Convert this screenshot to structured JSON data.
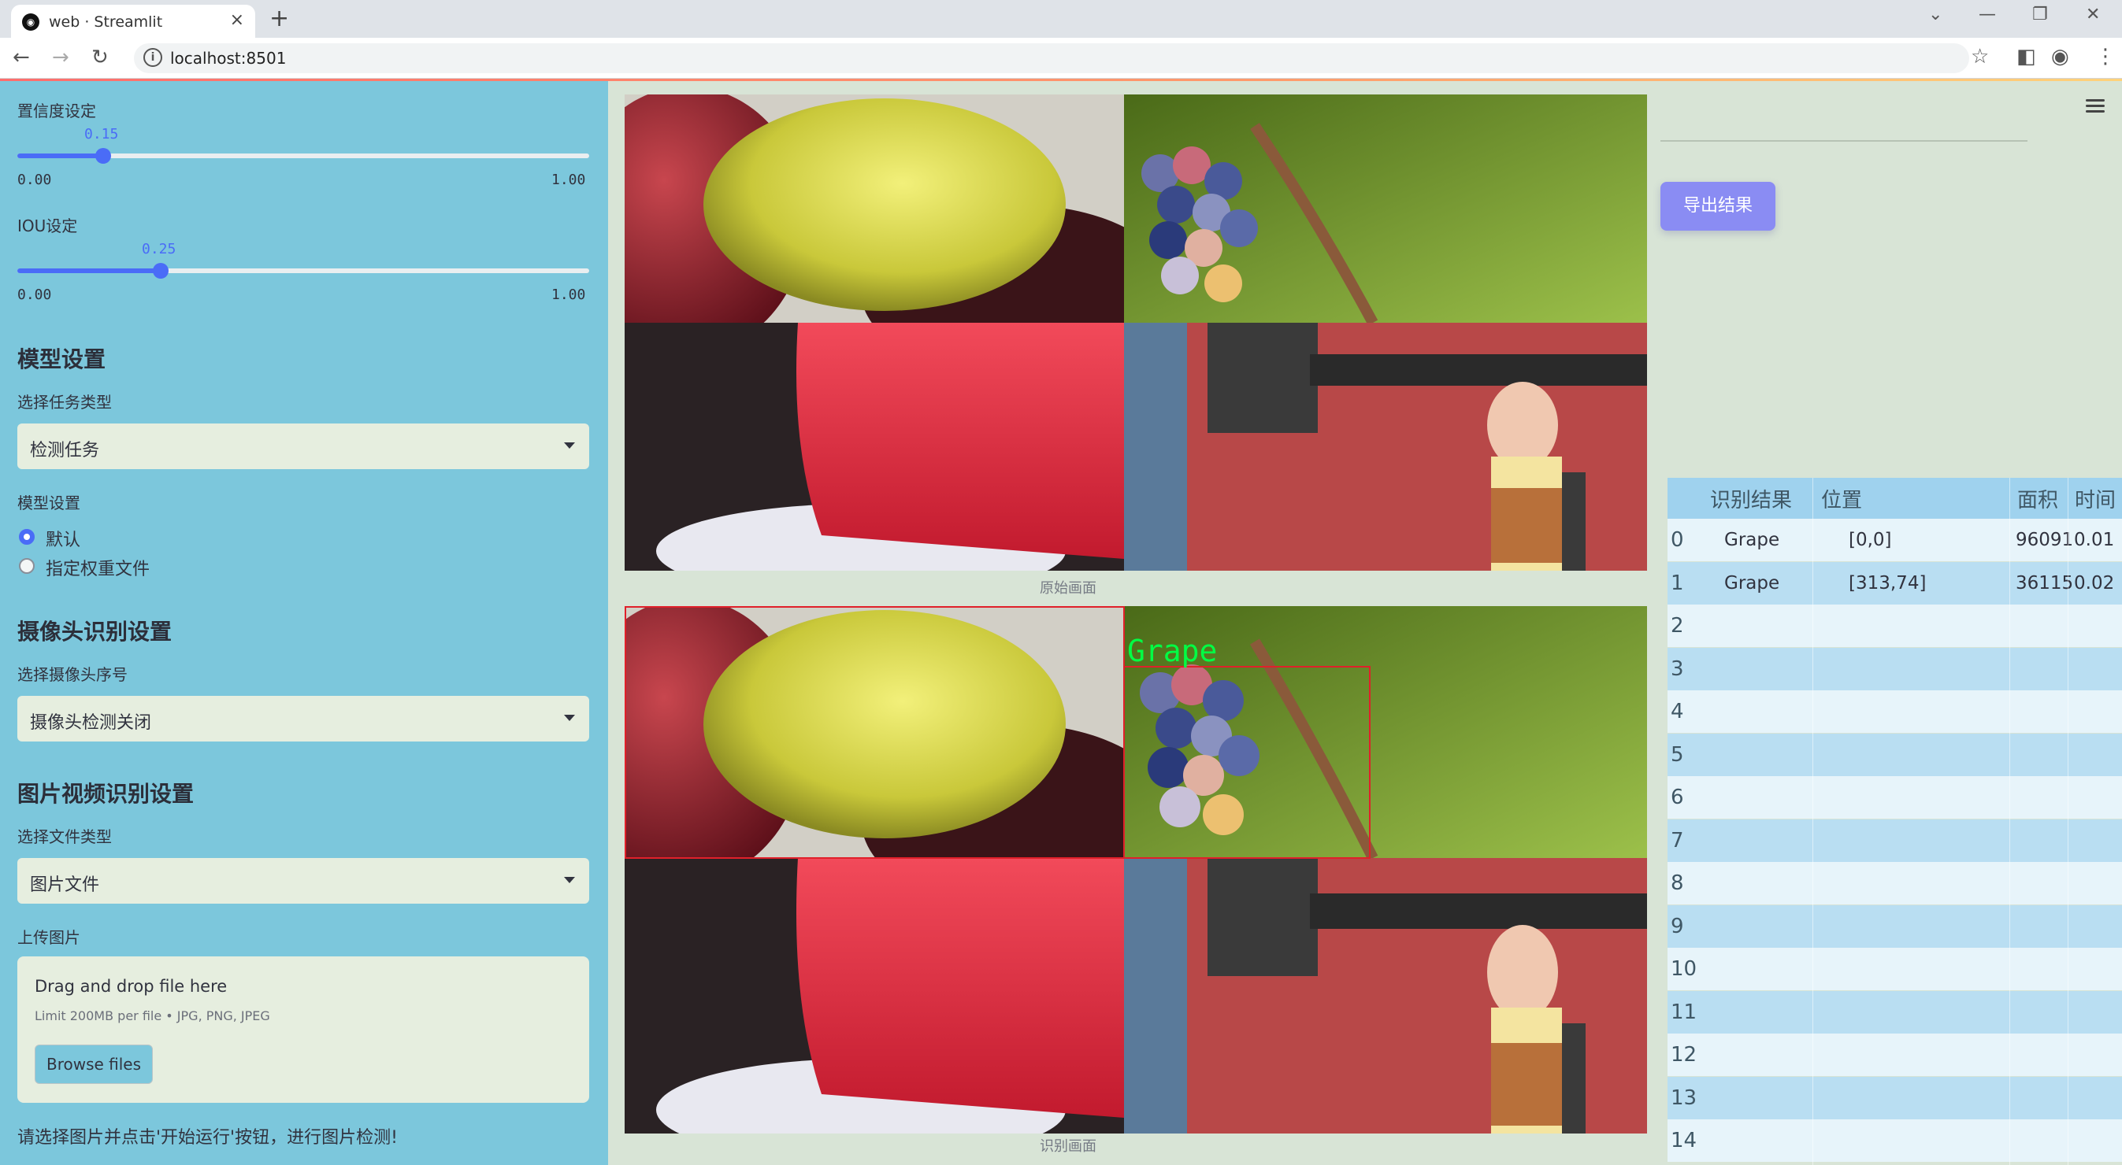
{
  "browser": {
    "tab_title": "web · Streamlit",
    "tab_close": "×",
    "new_tab": "+",
    "url": "localhost:8501"
  },
  "sidebar": {
    "confidence": {
      "label": "置信度设定",
      "value": "0.15",
      "min": "0.00",
      "max": "1.00",
      "fraction": 0.15
    },
    "iou": {
      "label": "IOU设定",
      "value": "0.25",
      "min": "0.00",
      "max": "1.00",
      "fraction": 0.25
    },
    "model_section": "模型设置",
    "task_label": "选择任务类型",
    "task_value": "检测任务",
    "model_label": "模型设置",
    "model_options": [
      "默认",
      "指定权重文件"
    ],
    "model_selected": 0,
    "camera_section": "摄像头识别设置",
    "camera_label": "选择摄像头序号",
    "camera_value": "摄像头检测关闭",
    "media_section": "图片视频识别设置",
    "filetype_label": "选择文件类型",
    "filetype_value": "图片文件",
    "upload_label": "上传图片",
    "upload_title": "Drag and drop file here",
    "upload_limit": "Limit 200MB per file • JPG, PNG, JPEG",
    "browse_button": "Browse files",
    "footer_text": "请选择图片并点击'开始运行'按钮，进行图片检测!"
  },
  "main": {
    "original_caption": "原始画面",
    "result_caption": "识别画面",
    "detection_label": "Grape",
    "detection_color": "#00ff44",
    "box_color": "#e0202a"
  },
  "results": {
    "export_button": "导出结果",
    "columns": [
      "识别结果",
      "位置",
      "面积",
      "时间"
    ],
    "rows": [
      {
        "index": "0",
        "label": "Grape",
        "position": "[0,0]",
        "area": "96091",
        "time": "0.01"
      },
      {
        "index": "1",
        "label": "Grape",
        "position": "[313,74]",
        "area": "36115",
        "time": "0.02"
      },
      {
        "index": "2",
        "label": "",
        "position": "",
        "area": "",
        "time": ""
      },
      {
        "index": "3",
        "label": "",
        "position": "",
        "area": "",
        "time": ""
      },
      {
        "index": "4",
        "label": "",
        "position": "",
        "area": "",
        "time": ""
      },
      {
        "index": "5",
        "label": "",
        "position": "",
        "area": "",
        "time": ""
      },
      {
        "index": "6",
        "label": "",
        "position": "",
        "area": "",
        "time": ""
      },
      {
        "index": "7",
        "label": "",
        "position": "",
        "area": "",
        "time": ""
      },
      {
        "index": "8",
        "label": "",
        "position": "",
        "area": "",
        "time": ""
      },
      {
        "index": "9",
        "label": "",
        "position": "",
        "area": "",
        "time": ""
      },
      {
        "index": "10",
        "label": "",
        "position": "",
        "area": "",
        "time": ""
      },
      {
        "index": "11",
        "label": "",
        "position": "",
        "area": "",
        "time": ""
      },
      {
        "index": "12",
        "label": "",
        "position": "",
        "area": "",
        "time": ""
      },
      {
        "index": "13",
        "label": "",
        "position": "",
        "area": "",
        "time": ""
      },
      {
        "index": "14",
        "label": "",
        "position": "",
        "area": "",
        "time": ""
      }
    ]
  }
}
